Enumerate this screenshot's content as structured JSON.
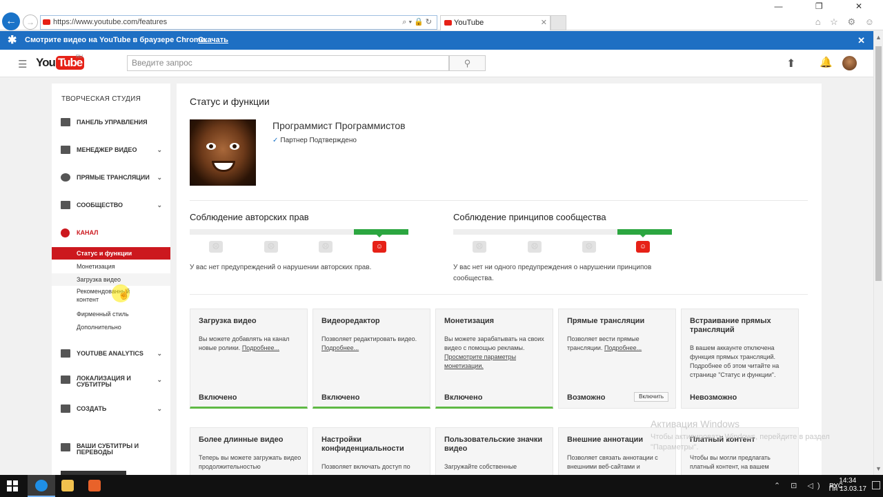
{
  "browser": {
    "url": "https://www.youtube.com/features",
    "tab_title": "YouTube",
    "window_controls": "—  ❐  ✕",
    "toolbar_icons": "⌂ ☆ ⚙ ☺"
  },
  "banner": {
    "text": "Смотрите видео на YouTube в браузере Chrome.",
    "link": "Скачать"
  },
  "header": {
    "logo_you": "You",
    "logo_tube": "Tube",
    "logo_region": "RU",
    "search_placeholder": "Введите запрос"
  },
  "sidebar": {
    "title": "ТВОРЧЕСКАЯ СТУДИЯ",
    "items": [
      {
        "label": "ПАНЕЛЬ УПРАВЛЕНИЯ"
      },
      {
        "label": "МЕНЕДЖЕР ВИДЕО"
      },
      {
        "label": "ПРЯМЫЕ ТРАНСЛЯЦИИ"
      },
      {
        "label": "СООБЩЕСТВО"
      },
      {
        "label": "КАНАЛ"
      },
      {
        "label": "YOUTUBE ANALYTICS"
      },
      {
        "label": "ЛОКАЛИЗАЦИЯ И СУБТИТРЫ"
      },
      {
        "label": "СОЗДАТЬ"
      },
      {
        "label": "ВАШИ СУБТИТРЫ И ПЕРЕВОДЫ"
      }
    ],
    "channel_sub": [
      {
        "label": "Статус и функции"
      },
      {
        "label": "Монетизация"
      },
      {
        "label": "Загрузка видео"
      },
      {
        "label": "Рекомендованный контент"
      },
      {
        "label": "Фирменный стиль"
      },
      {
        "label": "Дополнительно"
      }
    ]
  },
  "main": {
    "title": "Статус и функции",
    "channel_name": "Программист Программистов",
    "partner": "Партнер Подтверждено",
    "copyright": {
      "title": "Соблюдение авторских прав",
      "note": "У вас нет предупреждений о нарушении авторских прав."
    },
    "community": {
      "title": "Соблюдение принципов сообщества",
      "note": "У вас нет ни одного предупреждения о нарушении принципов сообщества."
    },
    "cards": [
      {
        "title": "Загрузка видео",
        "desc": "Вы можете добавлять на канал новые ролики.",
        "link": "Подробнее...",
        "status": "Включено"
      },
      {
        "title": "Видеоредактор",
        "desc": "Позволяет редактировать видео.",
        "link": "Подробнее...",
        "status": "Включено"
      },
      {
        "title": "Монетизация",
        "desc": "Вы можете зарабатывать на своих видео с помощью рекламы.",
        "link": "Просмотрите параметры монетизации.",
        "status": "Включено"
      },
      {
        "title": "Прямые трансляции",
        "desc": "Позволяет вести прямые трансляции.",
        "link": "Подробнее...",
        "status": "Возможно",
        "button": "Включить"
      },
      {
        "title": "Встраивание прямых трансляций",
        "desc": "В вашем аккаунте отключена функция прямых трансляций. Подробнее об этом читайте на странице \"Статус и функции\".",
        "link": "",
        "status": "Невозможно"
      }
    ],
    "cards2": [
      {
        "title": "Более длинные видео",
        "desc": "Теперь вы можете загружать видео продолжительностью"
      },
      {
        "title": "Настройки конфиденциальности",
        "desc": "Позволяет включать доступ по"
      },
      {
        "title": "Пользовательские значки видео",
        "desc": "Загружайте собственные"
      },
      {
        "title": "Внешние аннотации",
        "desc": "Позволяет связать аннотации с внешними веб-сайтами и"
      },
      {
        "title": "Платный контент",
        "desc": "Чтобы вы могли предлагать платный контент, на вашем"
      }
    ]
  },
  "watermark": {
    "line1": "Активация Windows",
    "line2": "Чтобы активировать Windows, перейдите в раздел \"Параметры\"."
  },
  "taskbar": {
    "tray": "⌃ ⊡ ◁) ▭",
    "lang": "РУС",
    "time": "14:34",
    "date": "Пн 13.03.17"
  },
  "colors": {
    "accent_blue": "#1e6fc3",
    "youtube_red": "#e62117",
    "green": "#2ba640"
  }
}
